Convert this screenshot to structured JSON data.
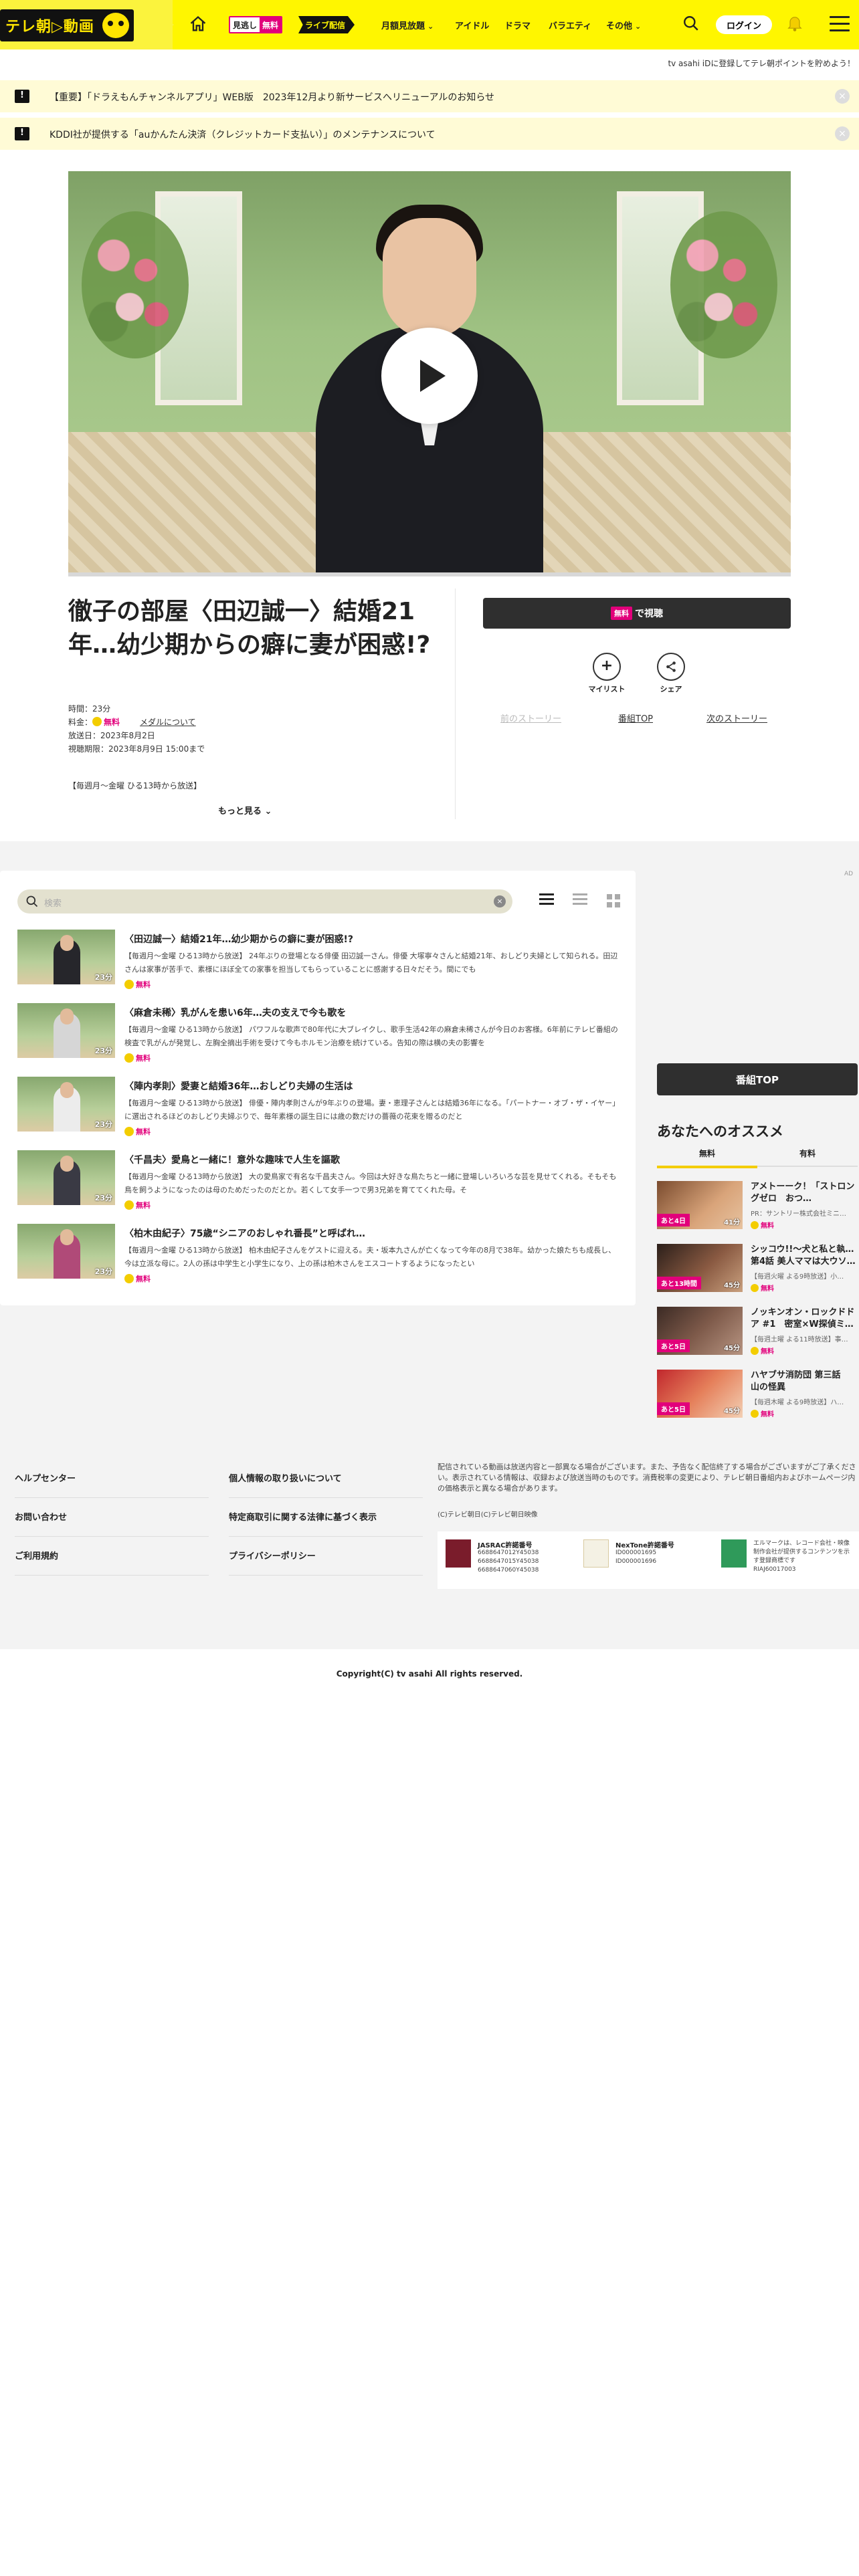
{
  "header": {
    "logo_text": "テレ朝▷動画",
    "badge_free": {
      "part1": "見逃し",
      "part2": "無料"
    },
    "badge_live": "ライブ配信",
    "nav": [
      {
        "label": "月額見放題",
        "has_chevron": true
      },
      {
        "label": "アイドル",
        "has_chevron": false
      },
      {
        "label": "ドラマ",
        "has_chevron": false
      },
      {
        "label": "バラエティ",
        "has_chevron": false
      },
      {
        "label": "その他",
        "has_chevron": true
      }
    ],
    "login_label": "ログイン",
    "icons": [
      "home-icon",
      "search-icon",
      "bell-icon",
      "menu-icon"
    ],
    "accent_color": "#fff600",
    "brand_pink": "#e2007b"
  },
  "register_text": "tv asahi iDに登録してテレ朝ポイントを貯めよう！",
  "notices": [
    {
      "text": "【重要】「ドラえもんチャンネルアプリ」WEB版　2023年12月より新サービスへリニューアルのお知らせ"
    },
    {
      "text": "KDDI社が提供する「auかんたん決済（クレジットカード支払い）」のメンテナンスについて"
    }
  ],
  "episode": {
    "title": "徹子の部屋〈田辺誠一〉結婚21年…幼少期からの癖に妻が困惑!?",
    "time_label": "時間：23分",
    "price_label": "料金：",
    "price_value": "無料",
    "help_link": "メダルについて",
    "aired": "放送日：2023年8月2日",
    "deadline": "視聴期限：2023年8月9日 15:00まで",
    "schedule": "【毎週月～金曜 ひる13時から放送】",
    "more_label": "もっと見る",
    "watch_badge": "無料",
    "watch_label": "で視聴",
    "mylist_label": "マイリスト",
    "share_label": "シェア",
    "prev_story": "前のストーリー",
    "program_top": "番組TOP",
    "next_story": "次のストーリー"
  },
  "list": {
    "search_placeholder": "検索",
    "items": [
      {
        "title": "〈田辺誠一〉結婚21年…幼少期からの癖に妻が困惑!?",
        "desc": "【毎週月～金曜 ひる13時から放送】 24年ぶりの登場となる俳優 田辺誠一さん。俳優 大塚寧々さんと結婚21年、おしどり夫婦として知られる。田辺さんは家事が苦手で、素様にほぼ全ての家事を担当してもらっていることに感謝する日々だそう。間にでも",
        "duration": "23分",
        "free": "無料"
      },
      {
        "title": "〈麻倉未稀〉乳がんを患い6年…夫の支えで今も歌を",
        "desc": "【毎週月～金曜 ひる13時から放送】 パワフルな歌声で80年代に大ブレイクし、歌手生活42年の麻倉未稀さんが今日のお客様。6年前にテレビ番組の検査で乳がんが発覚し、左胸全摘出手術を受けて今もホルモン治療を続けている。告知の際は横の夫の影響を",
        "duration": "23分",
        "free": "無料"
      },
      {
        "title": "〈陣内孝則〉愛妻と結婚36年…おしどり夫婦の生活は",
        "desc": "【毎週月～金曜 ひる13時から放送】 俳優・陣内孝則さんが9年ぶりの登場。妻・恵理子さんとは結婚36年になる。「パートナー・オブ・ザ・イヤー」に選出されるほどのおしどり夫婦ぶりで、毎年素様の誕生日には歳の数だけの薔薇の花束を贈るのだと",
        "duration": "23分",
        "free": "無料"
      },
      {
        "title": "〈千昌夫〉愛鳥と一緒に！意外な趣味で人生を謳歌",
        "desc": "【毎週月～金曜 ひる13時から放送】 大の愛鳥家で有名な千昌夫さん。今回は大好きな鳥たちと一緒に登場しいろいろな芸を見せてくれる。そもそも鳥を飼うようになったのは母のためだったのだとか。若くして女手一つで男3兄弟を育ててくれた母。そ",
        "duration": "23分",
        "free": "無料"
      },
      {
        "title": "〈柏木由紀子〉75歳“シニアのおしゃれ番長”と呼ばれ…",
        "desc": "【毎週月～金曜 ひる13時から放送】 柏木由紀子さんをゲストに迎える。夫・坂本九さんが亡くなって今年の8月で38年。幼かった娘たちも成長し、今は立派な母に。2人の孫は中学生と小学生になり、上の孫は柏木さんをエスコートするようになったとい",
        "duration": "23分",
        "free": "無料"
      }
    ]
  },
  "sidebar": {
    "ad_mark": "AD",
    "program_top_label": "番組TOP",
    "rec_title": "あなたへのオススメ",
    "tabs": [
      "無料",
      "有料"
    ],
    "items": [
      {
        "title": "アメトーーク！「ストロングゼロ　おつ…",
        "sub": "PR：サントリー株式会社ミニ…",
        "days": "あと4日",
        "duration": "41分",
        "free": "無料"
      },
      {
        "title": "シッコウ!!～犬と私と執…第4話 美人ママは大ウソ…",
        "sub": "【毎週火曜 よる9時放送】小…",
        "days": "あと13時間",
        "duration": "45分",
        "free": "無料"
      },
      {
        "title": "ノッキンオン・ロックドドア #1　密室×W探偵ミ…",
        "sub": "【毎週土曜 よる11時放送】事…",
        "days": "あと5日",
        "duration": "45分",
        "free": "無料"
      },
      {
        "title": "ハヤブサ消防団 第三話　山の怪異",
        "sub": "【毎週木曜 よる9時放送】ハ…",
        "days": "あと5日",
        "duration": "45分",
        "free": "無料"
      }
    ]
  },
  "footer": {
    "links_col1": [
      "ヘルプセンター",
      "お問い合わせ",
      "ご利用規約"
    ],
    "links_col2": [
      "個人情報の取り扱いについて",
      "特定商取引に関する法律に基づく表示",
      "プライバシーポリシー"
    ],
    "legal_text": "配信されている動画は放送内容と一部異なる場合がございます。また、予告なく配信終了する場合がございますがご了承ください。表示されている情報は、収録および放送当時のものです。消費税率の変更により、テレビ朝日番組内およびホームページ内の価格表示と異なる場合があります。",
    "legal_copy": "(C)テレビ朝日(C)テレビ朝日映像",
    "licenses": [
      {
        "name": "JASRAC許諾番号",
        "numbers": "6688647012Y45038\n6688647015Y45038\n6688647060Y45038"
      },
      {
        "name": "NexTone許諾番号",
        "numbers": "ID000001695\nID000001696"
      },
      {
        "name": "エルマーク",
        "numbers": "エルマークは、レコード会社・映像制作会社が提供するコンテンツを示す登録商標です\nRIAJ60017003"
      }
    ],
    "copyright": "Copyright(C) tv asahi All rights reserved."
  }
}
